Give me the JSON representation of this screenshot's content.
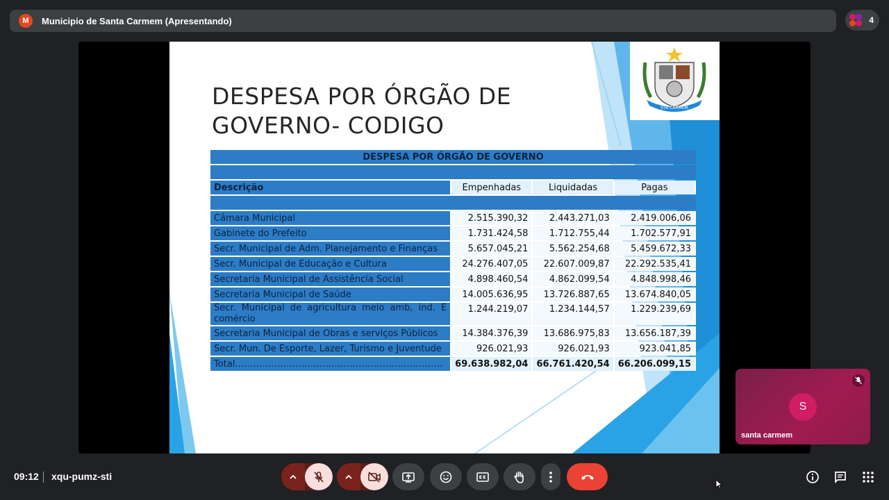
{
  "topbar": {
    "avatar_letter": "M",
    "title": "Municipio de Santa Carmem (Apresentando)",
    "participants_count": "4"
  },
  "slide": {
    "title_line1": "DESPESA POR ÓRGÃO DE",
    "title_line2": "GOVERNO- CODIGO",
    "logo_text": "STA CARMEM",
    "table": {
      "header": "DESPESA POR ÓRGÃO DE GOVERNO",
      "columns": [
        "Descrição",
        "Empenhadas",
        "Liquidadas",
        "Pagas"
      ],
      "rows": [
        {
          "desc": "Câmara Municipal",
          "emp": "2.515.390,32",
          "liq": "2.443.271,03",
          "pag": "2.419.006,06"
        },
        {
          "desc": "Gabinete do Prefeito",
          "emp": "1.731.424,58",
          "liq": "1.712.755,44",
          "pag": "1.702.577,91"
        },
        {
          "desc": "Secr. Municipal de Adm. Planejamento e Finanças",
          "emp": "5.657.045,21",
          "liq": "5.562.254,68",
          "pag": "5.459.672,33"
        },
        {
          "desc": "Secr. Municipal de Educação e Cultura",
          "emp": "24.276.407,05",
          "liq": "22.607.009,87",
          "pag": "22.292.535,41"
        },
        {
          "desc": "Secretaria Municipal de Assistência Social",
          "emp": "4.898.460,54",
          "liq": "4.862.099,54",
          "pag": "4.848.998,46"
        },
        {
          "desc": "Secretaria Municipal de Saúde",
          "emp": "14.005.636,95",
          "liq": "13.726.887,65",
          "pag": "13.674.840,05"
        },
        {
          "desc": "Secr. Municipal de agricultura meio amb, ind. E comércio",
          "emp": "1.244.219,07",
          "liq": "1.234.144,57",
          "pag": "1.229.239,69"
        },
        {
          "desc": "Secretaria Municipal de Obras e serviços Públicos",
          "emp": "14.384.376,39",
          "liq": "13.686.975,83",
          "pag": "13.656.187,39"
        },
        {
          "desc": "Secr. Mun. De Esporte, Lazer, Turismo e Juventude",
          "emp": "926.021,93",
          "liq": "926.021,93",
          "pag": "923.041,85"
        }
      ],
      "total": {
        "desc": "Total……………………………………………………………",
        "emp": "69.638.982,04",
        "liq": "66.761.420,54",
        "pag": "66.206.099,15"
      }
    }
  },
  "tile": {
    "avatar_letter": "S",
    "name": "santa carmem"
  },
  "bottombar": {
    "time": "09:12",
    "meeting_code": "xqu-pumz-sti"
  },
  "colors": {
    "end_call": "#ea4335",
    "table_blue": "#2c7cc6",
    "tile_bg": "#a11b51"
  }
}
